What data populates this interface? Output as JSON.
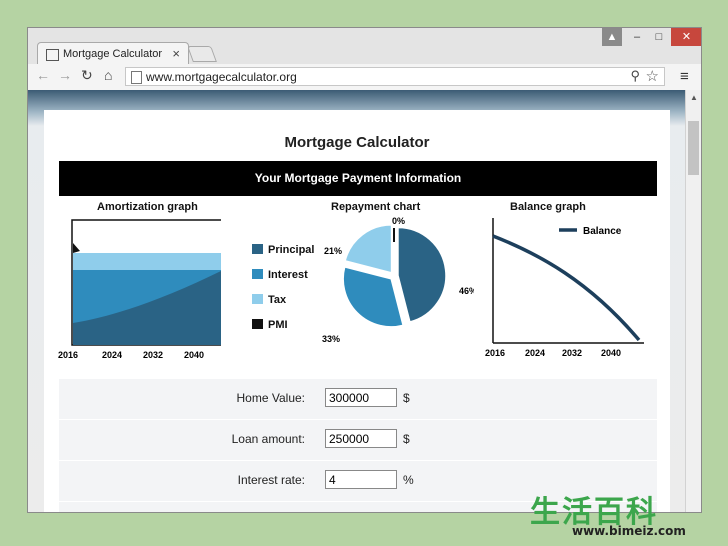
{
  "browser": {
    "tab_title": "Mortgage Calculator",
    "url": "www.mortgagecalculator.org",
    "window_buttons": {
      "minimize": "–",
      "maximize": "□",
      "close": "✕"
    }
  },
  "page": {
    "title": "Mortgage Calculator",
    "banner": "Your Mortgage Payment Information"
  },
  "amortization": {
    "title": "Amortization graph",
    "x_ticks": [
      "2016",
      "2024",
      "2032",
      "2040"
    ],
    "legend": [
      {
        "label": "Principal",
        "color": "#2a6385"
      },
      {
        "label": "Interest",
        "color": "#2f8cbd"
      },
      {
        "label": "Tax",
        "color": "#8fcdeb"
      },
      {
        "label": "PMI",
        "color": "#111111"
      }
    ]
  },
  "repayment": {
    "title": "Repayment chart",
    "slices": [
      {
        "label": "46%",
        "value": 46,
        "color": "#2a6385"
      },
      {
        "label": "33%",
        "value": 33,
        "color": "#2f8cbd"
      },
      {
        "label": "21%",
        "value": 21,
        "color": "#8fcdeb"
      },
      {
        "label": "0%",
        "value": 0,
        "color": "#111111"
      }
    ]
  },
  "balance": {
    "title": "Balance graph",
    "legend_label": "Balance",
    "x_ticks": [
      "2016",
      "2024",
      "2032",
      "2040"
    ]
  },
  "form": {
    "rows": [
      {
        "label": "Home Value:",
        "value": "300000",
        "unit": "$"
      },
      {
        "label": "Loan amount:",
        "value": "250000",
        "unit": "$"
      },
      {
        "label": "Interest rate:",
        "value": "4",
        "unit": "%"
      }
    ]
  },
  "watermark": {
    "cn": "生活百科",
    "url": "www.bimeiz.com"
  }
}
